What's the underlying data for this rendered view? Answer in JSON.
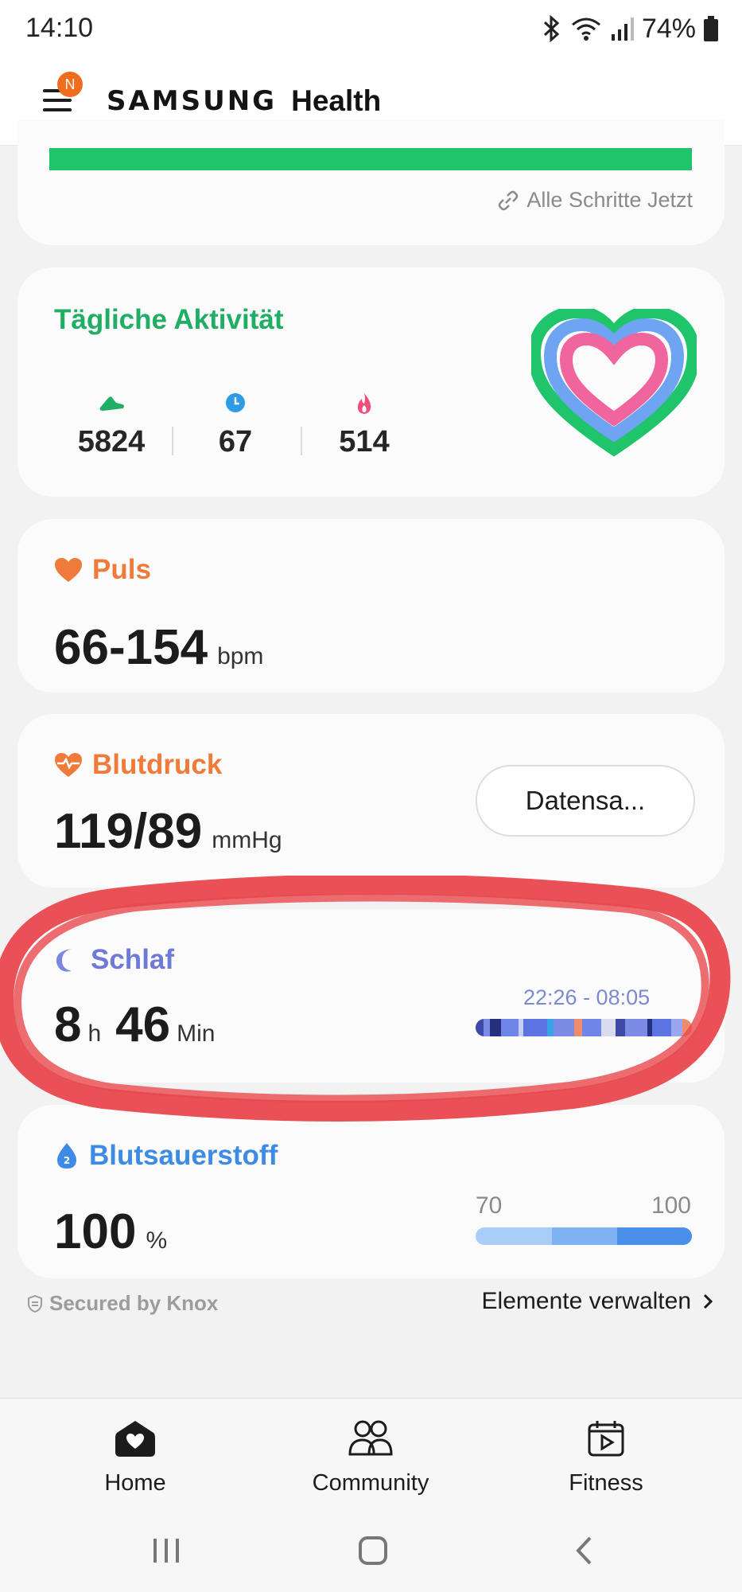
{
  "status_bar": {
    "time": "14:10",
    "battery": "74%"
  },
  "header": {
    "brand_primary": "SAMSUNG",
    "brand_secondary": "Health",
    "notification_badge": "N"
  },
  "steps_card": {
    "link_label": "Alle Schritte Jetzt",
    "bar_color": "#1fc46b"
  },
  "activity": {
    "title": "Tägliche Aktivität",
    "metrics": [
      {
        "icon": "shoe-icon",
        "value": "5824",
        "color": "#1fae64"
      },
      {
        "icon": "clock-icon",
        "value": "67",
        "color": "#2d9be6"
      },
      {
        "icon": "flame-icon",
        "value": "514",
        "color": "#ee4f7b"
      }
    ]
  },
  "pulse": {
    "title": "Puls",
    "value": "66-154",
    "unit": "bpm"
  },
  "blood_pressure": {
    "title": "Blutdruck",
    "value": "119/89",
    "unit": "mmHg",
    "button_label": "Datensa..."
  },
  "sleep": {
    "title": "Schlaf",
    "hours": "8",
    "hours_unit": "h",
    "minutes": "46",
    "minutes_unit": "Min",
    "time_range": "22:26 - 08:05"
  },
  "oxygen": {
    "title": "Blutsauerstoff",
    "value": "100",
    "unit": "%",
    "range_min": "70",
    "range_max": "100"
  },
  "footer": {
    "knox_label": "Secured by Knox",
    "manage_label": "Elemente verwalten"
  },
  "bottom_nav": {
    "items": [
      {
        "label": "Home"
      },
      {
        "label": "Community"
      },
      {
        "label": "Fitness"
      }
    ]
  },
  "colors": {
    "activity_green": "#1fae64",
    "orange": "#f07a3a",
    "sleep_purple": "#6f79d6",
    "oxygen_blue": "#3d8be4",
    "annotation_red": "#e8484d"
  }
}
